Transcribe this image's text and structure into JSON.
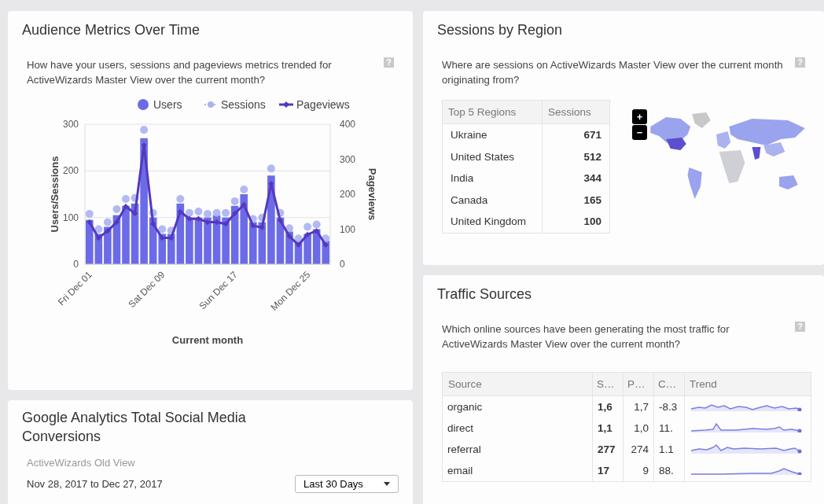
{
  "audience_card": {
    "title": "Audience Metrics Over Time",
    "question": "How have your users, sessions and pageviews metrics trended for ActiveWizards Master View over the current month?",
    "help_icon": "?",
    "chart_data": {
      "type": "bar",
      "xlabel": "Current month",
      "ylabel": "Users/Sessions",
      "y2label": "Pageviews",
      "categories": [
        "Fri Dec 01",
        null,
        null,
        null,
        null,
        null,
        null,
        null,
        "Sat Dec 09",
        null,
        null,
        null,
        null,
        null,
        null,
        null,
        "Sun Dec 17",
        null,
        null,
        null,
        null,
        null,
        null,
        null,
        "Mon Dec 25",
        null,
        null
      ],
      "series": [
        {
          "name": "Users",
          "type": "bar",
          "color": "#6b6be8",
          "values": [
            95,
            65,
            80,
            105,
            125,
            130,
            270,
            100,
            65,
            65,
            130,
            100,
            100,
            100,
            105,
            100,
            125,
            150,
            90,
            90,
            190,
            100,
            70,
            50,
            65,
            75,
            50
          ]
        },
        {
          "name": "Sessions",
          "type": "scatter",
          "color": "#aab2f0",
          "values": [
            108,
            75,
            90,
            118,
            140,
            142,
            288,
            110,
            75,
            72,
            140,
            110,
            113,
            108,
            110,
            110,
            135,
            160,
            97,
            100,
            205,
            110,
            77,
            55,
            80,
            85,
            55
          ]
        },
        {
          "name": "Pageviews",
          "type": "line",
          "marker": "diamond",
          "axis": "y2",
          "color": "#5438c0",
          "values": [
            120,
            75,
            95,
            120,
            165,
            145,
            340,
            115,
            75,
            75,
            150,
            130,
            130,
            120,
            120,
            115,
            145,
            170,
            110,
            105,
            230,
            125,
            80,
            55,
            85,
            95,
            55
          ]
        }
      ],
      "ylim": [
        0,
        300
      ],
      "yticks": [
        0,
        100,
        200,
        300
      ],
      "y2lim": [
        0,
        400
      ],
      "y2ticks": [
        0,
        100,
        200,
        300,
        400
      ],
      "legend": "top"
    }
  },
  "social_card": {
    "title": "Google Analytics Total Social Media Conversions",
    "view": "ActiveWizards Old View",
    "date_range": "Nov 28, 2017 to Dec 27, 2017",
    "period_dropdown": "Last 30 Days"
  },
  "region_card": {
    "title": "Sessions by Region",
    "question": "Where are sessions on ActiveWizards Master View over the current month originating from?",
    "help_icon": "?",
    "columns": [
      "Top 5 Regions",
      "Sessions"
    ],
    "rows": [
      {
        "region": "Ukraine",
        "sessions": "671"
      },
      {
        "region": "United States",
        "sessions": "512"
      },
      {
        "region": "India",
        "sessions": "344"
      },
      {
        "region": "Canada",
        "sessions": "165"
      },
      {
        "region": "United Kingdom",
        "sessions": "100"
      }
    ],
    "zoom_in": "+",
    "zoom_out": "−"
  },
  "traffic_card": {
    "title": "Traffic Sources",
    "question": "Which online sources have been generating the most traffic for ActiveWizards Master View over the current month?",
    "help_icon": "?",
    "columns": [
      "Source",
      "S…",
      "P…",
      "C…",
      "Trend"
    ],
    "rows": [
      {
        "source": "organic",
        "column_2": "1,6",
        "column_3": "1,7",
        "column_4": "-8.3"
      },
      {
        "source": "direct",
        "column_2": "1,1",
        "column_3": "1,0",
        "column_4": "11."
      },
      {
        "source": "referral",
        "column_2": "277",
        "column_3": "274",
        "column_4": "1.1"
      },
      {
        "source": "email",
        "column_2": "17",
        "column_3": "9",
        "column_4": "88."
      }
    ]
  }
}
